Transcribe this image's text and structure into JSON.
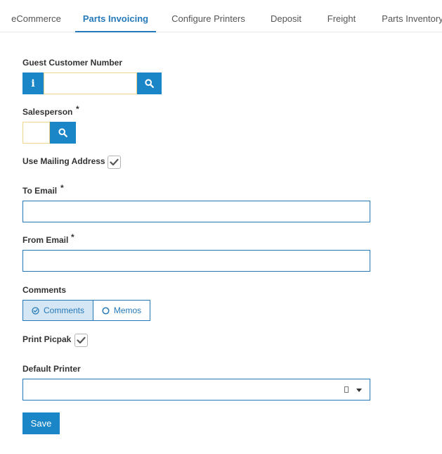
{
  "tabs": [
    {
      "label": "eCommerce"
    },
    {
      "label": "Parts Invoicing"
    },
    {
      "label": "Configure Printers"
    },
    {
      "label": "Deposit"
    },
    {
      "label": "Freight"
    },
    {
      "label": "Parts Inventory"
    }
  ],
  "active_tab": "Parts Invoicing",
  "form": {
    "guest_customer_label": "Guest Customer Number",
    "guest_customer_value": "",
    "salesperson_label": "Salesperson",
    "salesperson_value": "",
    "required_mark": "*",
    "use_mailing_label": "Use Mailing Address",
    "use_mailing_checked": true,
    "to_email_label": "To Email",
    "to_email_value": "",
    "from_email_label": "From Email",
    "from_email_value": "",
    "comments_label": "Comments",
    "comments_options": [
      "Comments",
      "Memos"
    ],
    "comments_selected": "Comments",
    "print_picpak_label": "Print Picpak",
    "print_picpak_checked": true,
    "default_printer_label": "Default Printer",
    "default_printer_value": "",
    "save_label": "Save"
  },
  "colors": {
    "accent": "#1a86c8",
    "border": "#2579b8",
    "input_focus": "#f0d58c"
  }
}
